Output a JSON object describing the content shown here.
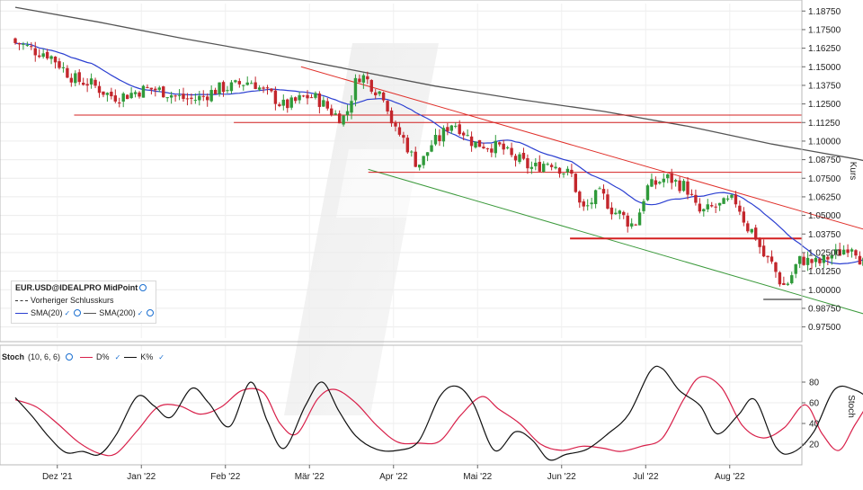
{
  "chart_data": [
    {
      "type": "candlestick",
      "symbol_label": "EUR.USD@IDEALPRO MidPoint",
      "ylabel": "Kurs",
      "ylim": [
        0.9675,
        1.1925
      ],
      "y_ticks": [
        "1.18750",
        "1.17500",
        "1.16250",
        "1.15000",
        "1.13750",
        "1.12500",
        "1.11250",
        "1.10000",
        "1.08750",
        "1.07500",
        "1.06250",
        "1.05000",
        "1.03750",
        "1.02500",
        "1.01250",
        "1.00000",
        "0.98750",
        "0.97500"
      ],
      "x_ticks": [
        "Dez '21",
        "Jan '22",
        "Feb '22",
        "Mär '22",
        "Apr '22",
        "Mai '22",
        "Jun '22",
        "Jul '22",
        "Aug '22"
      ],
      "series_close_anchors": [
        {
          "month": 0.0,
          "value": 1.166
        },
        {
          "month": 0.3,
          "value": 1.16
        },
        {
          "month": 0.8,
          "value": 1.14
        },
        {
          "month": 1.2,
          "value": 1.13
        },
        {
          "month": 1.6,
          "value": 1.135
        },
        {
          "month": 2.1,
          "value": 1.128
        },
        {
          "month": 2.5,
          "value": 1.136
        },
        {
          "month": 2.8,
          "value": 1.14
        },
        {
          "month": 3.0,
          "value": 1.132
        },
        {
          "month": 3.2,
          "value": 1.124
        },
        {
          "month": 3.5,
          "value": 1.13
        },
        {
          "month": 3.9,
          "value": 1.116
        },
        {
          "month": 4.1,
          "value": 1.144
        },
        {
          "month": 4.35,
          "value": 1.133
        },
        {
          "month": 4.55,
          "value": 1.105
        },
        {
          "month": 4.8,
          "value": 1.085
        },
        {
          "month": 5.0,
          "value": 1.1
        },
        {
          "month": 5.2,
          "value": 1.112
        },
        {
          "month": 5.5,
          "value": 1.098
        },
        {
          "month": 5.75,
          "value": 1.096
        },
        {
          "month": 5.95,
          "value": 1.088
        },
        {
          "month": 6.15,
          "value": 1.082
        },
        {
          "month": 6.35,
          "value": 1.086
        },
        {
          "month": 6.6,
          "value": 1.078
        },
        {
          "month": 6.75,
          "value": 1.054
        },
        {
          "month": 6.95,
          "value": 1.064
        },
        {
          "month": 7.15,
          "value": 1.052
        },
        {
          "month": 7.35,
          "value": 1.044
        },
        {
          "month": 7.55,
          "value": 1.07
        },
        {
          "month": 7.75,
          "value": 1.075
        },
        {
          "month": 7.95,
          "value": 1.07
        },
        {
          "month": 8.15,
          "value": 1.052
        },
        {
          "month": 8.35,
          "value": 1.056
        },
        {
          "month": 8.55,
          "value": 1.06
        },
        {
          "month": 8.75,
          "value": 1.04
        },
        {
          "month": 8.95,
          "value": 1.02
        },
        {
          "month": 9.15,
          "value": 1.003
        },
        {
          "month": 9.35,
          "value": 1.02
        },
        {
          "month": 9.55,
          "value": 1.018
        },
        {
          "month": 9.75,
          "value": 1.024
        },
        {
          "month": 9.95,
          "value": 1.03
        },
        {
          "month": 10.1,
          "value": 1.018
        },
        {
          "month": 10.28,
          "value": 0.994
        }
      ],
      "sma200_anchors": [
        {
          "month": 0.0,
          "value": 1.19
        },
        {
          "month": 1.0,
          "value": 1.18
        },
        {
          "month": 2.0,
          "value": 1.169
        },
        {
          "month": 3.0,
          "value": 1.159
        },
        {
          "month": 4.0,
          "value": 1.148
        },
        {
          "month": 5.0,
          "value": 1.137
        },
        {
          "month": 6.0,
          "value": 1.128
        },
        {
          "month": 7.0,
          "value": 1.12
        },
        {
          "month": 8.0,
          "value": 1.11
        },
        {
          "month": 9.0,
          "value": 1.098
        },
        {
          "month": 10.0,
          "value": 1.088
        },
        {
          "month": 10.35,
          "value": 1.084
        }
      ],
      "horizontal_lines": [
        {
          "value": 1.1175,
          "month_from": 0.7,
          "month_to": 10.75,
          "color": "#d42020"
        },
        {
          "value": 1.1125,
          "month_from": 2.6,
          "month_to": 10.75,
          "color": "#d42020"
        },
        {
          "value": 1.079,
          "month_from": 4.2,
          "month_to": 10.75,
          "color": "#d42020"
        },
        {
          "value": 1.0345,
          "month_from": 6.6,
          "month_to": 10.75,
          "color": "#d42020",
          "width": 2
        },
        {
          "value": 0.9935,
          "month_from": 8.9,
          "month_to": 10.75,
          "color": "#111111"
        }
      ],
      "trend_lines": [
        {
          "month_from": 3.4,
          "value_from": 1.15,
          "month_to": 10.75,
          "value_to": 1.03,
          "color": "#e0302a"
        },
        {
          "month_from": 4.2,
          "value_from": 1.081,
          "month_to": 10.75,
          "value_to": 0.973,
          "color": "#3c9a3c"
        }
      ],
      "legend": [
        {
          "label": "EUR.USD@IDEALPRO MidPoint",
          "kind": "title"
        },
        {
          "label": "Vorheriger Schlusskurs",
          "color": "#333333",
          "dash": true
        },
        {
          "label": "SMA(20)",
          "color": "#2b3fd1"
        },
        {
          "label": "SMA(200)",
          "color": "#555555"
        }
      ],
      "colors": {
        "up": "#2f9a3a",
        "down": "#c3262c",
        "sma20": "#2b3fd1",
        "sma200": "#555555"
      }
    },
    {
      "type": "line",
      "title": "Stoch",
      "params": "(10, 6, 6)",
      "ylabel": "Stoch",
      "ylim": [
        0,
        100
      ],
      "y_ticks": [
        20,
        40,
        60,
        80
      ],
      "series": [
        {
          "name": "D%",
          "color": "#d8204a",
          "points": [
            [
              0.0,
              63
            ],
            [
              0.25,
              56
            ],
            [
              0.5,
              40
            ],
            [
              0.75,
              22
            ],
            [
              1.0,
              11
            ],
            [
              1.2,
              11
            ],
            [
              1.45,
              33
            ],
            [
              1.7,
              56
            ],
            [
              1.95,
              57
            ],
            [
              2.2,
              49
            ],
            [
              2.45,
              56
            ],
            [
              2.7,
              72
            ],
            [
              2.95,
              70
            ],
            [
              3.15,
              40
            ],
            [
              3.35,
              30
            ],
            [
              3.6,
              64
            ],
            [
              3.8,
              73
            ],
            [
              4.05,
              60
            ],
            [
              4.3,
              38
            ],
            [
              4.55,
              22
            ],
            [
              4.8,
              21
            ],
            [
              5.05,
              23
            ],
            [
              5.3,
              48
            ],
            [
              5.55,
              66
            ],
            [
              5.75,
              54
            ],
            [
              6.0,
              40
            ],
            [
              6.25,
              20
            ],
            [
              6.5,
              14
            ],
            [
              6.75,
              18
            ],
            [
              7.0,
              16
            ],
            [
              7.2,
              13
            ],
            [
              7.45,
              18
            ],
            [
              7.7,
              26
            ],
            [
              7.95,
              63
            ],
            [
              8.15,
              85
            ],
            [
              8.4,
              75
            ],
            [
              8.65,
              38
            ],
            [
              8.9,
              26
            ],
            [
              9.15,
              36
            ],
            [
              9.4,
              58
            ],
            [
              9.6,
              30
            ],
            [
              9.8,
              14
            ],
            [
              10.0,
              40
            ],
            [
              10.25,
              68
            ],
            [
              10.5,
              64
            ],
            [
              10.75,
              52
            ],
            [
              10.95,
              34
            ],
            [
              11.1,
              25
            ]
          ]
        },
        {
          "name": "K%",
          "color": "#111111",
          "points": [
            [
              0.0,
              65
            ],
            [
              0.2,
              47
            ],
            [
              0.4,
              27
            ],
            [
              0.6,
              12
            ],
            [
              0.8,
              13
            ],
            [
              1.0,
              10
            ],
            [
              1.2,
              29
            ],
            [
              1.45,
              66
            ],
            [
              1.65,
              57
            ],
            [
              1.85,
              46
            ],
            [
              2.1,
              74
            ],
            [
              2.3,
              60
            ],
            [
              2.55,
              37
            ],
            [
              2.8,
              80
            ],
            [
              3.0,
              42
            ],
            [
              3.2,
              16
            ],
            [
              3.45,
              57
            ],
            [
              3.65,
              80
            ],
            [
              3.85,
              52
            ],
            [
              4.05,
              28
            ],
            [
              4.3,
              15
            ],
            [
              4.55,
              14
            ],
            [
              4.8,
              23
            ],
            [
              5.05,
              66
            ],
            [
              5.25,
              76
            ],
            [
              5.45,
              59
            ],
            [
              5.7,
              14
            ],
            [
              5.95,
              32
            ],
            [
              6.15,
              24
            ],
            [
              6.35,
              5
            ],
            [
              6.55,
              10
            ],
            [
              6.8,
              15
            ],
            [
              7.05,
              30
            ],
            [
              7.3,
              49
            ],
            [
              7.55,
              90
            ],
            [
              7.7,
              93
            ],
            [
              7.9,
              72
            ],
            [
              8.15,
              57
            ],
            [
              8.35,
              30
            ],
            [
              8.6,
              48
            ],
            [
              8.8,
              63
            ],
            [
              9.05,
              17
            ],
            [
              9.25,
              12
            ],
            [
              9.5,
              32
            ],
            [
              9.75,
              73
            ],
            [
              10.0,
              72
            ],
            [
              10.2,
              62
            ],
            [
              10.4,
              56
            ],
            [
              10.55,
              62
            ],
            [
              10.8,
              32
            ],
            [
              10.95,
              13
            ],
            [
              11.1,
              12
            ]
          ]
        }
      ]
    }
  ]
}
